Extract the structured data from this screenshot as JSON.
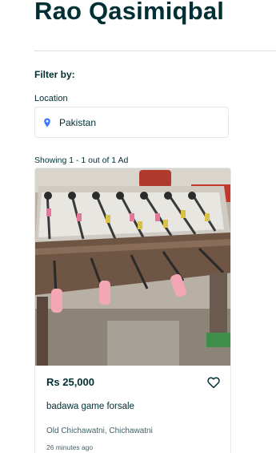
{
  "header": {
    "title": "Rao Qasimiqbal"
  },
  "filters": {
    "heading": "Filter by:",
    "location_label": "Location",
    "location_value": "Pakistan",
    "location_icon": "map-pin-icon"
  },
  "results": {
    "count_text": "Showing 1 - 1 out of 1 Ad"
  },
  "ads": [
    {
      "price": "Rs 25,000",
      "title": "badawa game forsale",
      "location": "Old Chichawatni, Chichawatni",
      "time": "26 minutes ago",
      "favorite_icon": "heart-icon"
    }
  ],
  "colors": {
    "text": "#002f34",
    "pin": "#3a77ff",
    "border": "#e3e8e9"
  }
}
